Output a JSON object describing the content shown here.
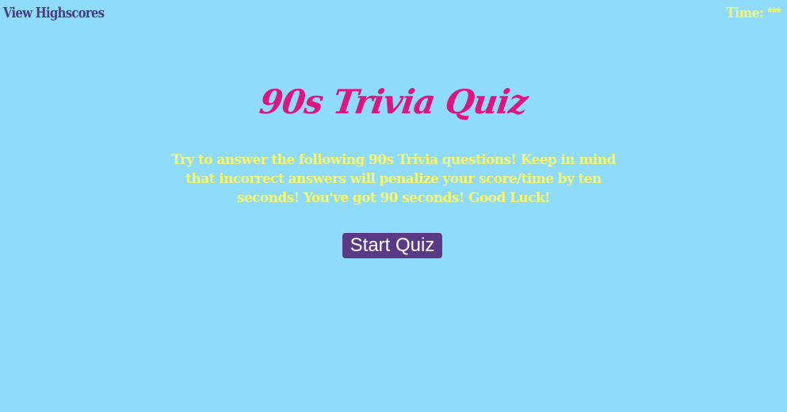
{
  "header": {
    "highscores_label": "View Highscores",
    "timer_label": "Time: ",
    "timer_value": "***"
  },
  "main": {
    "title": "90s Trivia Quiz",
    "intro": "Try to answer the following 90s Trivia questions! Keep in mind that incorrect answers will penalize your score/time by ten seconds! You've got 90 seconds! Good Luck!",
    "start_button_label": "Start Quiz"
  },
  "colors": {
    "background": "#8fdbfc",
    "title": "#e0147f",
    "intro_text": "#f6f76a",
    "timer_text": "#f6f76a",
    "highscores_link": "#4b3a85",
    "button_bg": "#5a3a87",
    "button_text": "#ffffff"
  }
}
